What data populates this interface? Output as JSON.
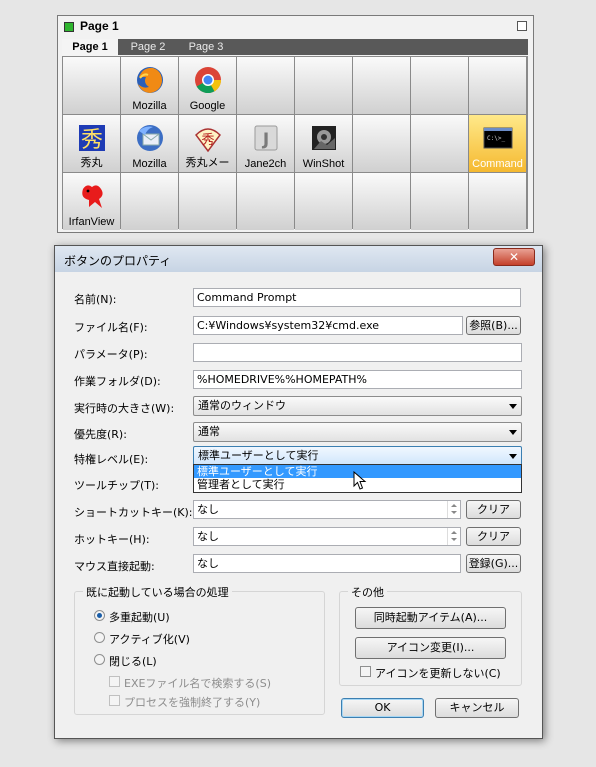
{
  "launcher": {
    "title": "Page 1",
    "tabs": [
      "Page 1",
      "Page 2",
      "Page 3"
    ],
    "row1": [
      "",
      "Mozilla",
      "Google",
      "",
      "",
      "",
      "",
      ""
    ],
    "row2": [
      "秀丸",
      "Mozilla",
      "秀丸メー",
      "Jane2ch",
      "WinShot",
      "",
      "",
      "Command"
    ],
    "row3": [
      "IrfanView",
      "",
      "",
      "",
      "",
      "",
      "",
      ""
    ]
  },
  "dialog": {
    "title": "ボタンのプロパティ",
    "close_glyph": "✕",
    "fields": {
      "name_label": "名前(N):",
      "name_value": "Command Prompt",
      "file_label": "ファイル名(F):",
      "file_value": "C:¥Windows¥system32¥cmd.exe",
      "browse_button": "参照(B)...",
      "param_label": "パラメータ(P):",
      "param_value": "",
      "workdir_label": "作業フォルダ(D):",
      "workdir_value": "%HOMEDRIVE%%HOMEPATH%",
      "size_label": "実行時の大きさ(W):",
      "size_value": "通常のウィンドウ",
      "priority_label": "優先度(R):",
      "priority_value": "通常",
      "privilege_label": "特権レベル(E):",
      "privilege_value": "標準ユーザーとして実行",
      "privilege_options": [
        "標準ユーザーとして実行",
        "管理者として実行"
      ],
      "tooltip_label": "ツールチップ(T):",
      "shortcut_label": "ショートカットキー(K):",
      "shortcut_value": "なし",
      "hotkey_label": "ホットキー(H):",
      "hotkey_value": "なし",
      "mouse_label": "マウス直接起動:",
      "mouse_value": "なし",
      "clear_button": "クリア",
      "register_button": "登録(G)..."
    },
    "running_group": {
      "title": "既に起動している場合の処理",
      "options": [
        "多重起動(U)",
        "アクティブ化(V)",
        "閉じる(L)"
      ],
      "selected_index": 0,
      "sub_checks": [
        "EXEファイル名で検索する(S)",
        "プロセスを強制終了する(Y)"
      ]
    },
    "other_group": {
      "title": "その他",
      "simul_button": "同時起動アイテム(A)...",
      "icon_button": "アイコン変更(I)...",
      "no_update_check": "アイコンを更新しない(C)"
    },
    "ok_button": "OK",
    "cancel_button": "キャンセル"
  }
}
